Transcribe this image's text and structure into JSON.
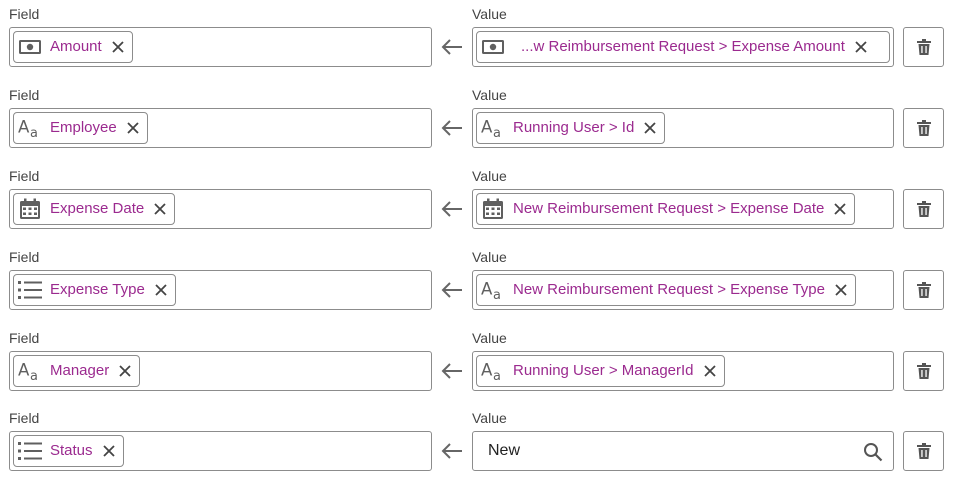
{
  "mappings": [
    {
      "field_label": "Field",
      "value_label": "Value",
      "field": {
        "icon": "money-icon",
        "text": "Amount"
      },
      "value": {
        "icon": "money-icon",
        "text": "...w Reimbursement Request > Expense Amount"
      }
    },
    {
      "field_label": "Field",
      "value_label": "Value",
      "field": {
        "icon": "text-type-icon",
        "text": "Employee"
      },
      "value": {
        "icon": "text-type-icon",
        "text": "Running User > Id"
      }
    },
    {
      "field_label": "Field",
      "value_label": "Value",
      "field": {
        "icon": "calendar-icon",
        "text": "Expense Date"
      },
      "value": {
        "icon": "calendar-icon",
        "text": "New Reimbursement Request > Expense Date"
      }
    },
    {
      "field_label": "Field",
      "value_label": "Value",
      "field": {
        "icon": "list-icon",
        "text": "Expense Type"
      },
      "value": {
        "icon": "text-type-icon",
        "text": "New Reimbursement Request > Expense Type"
      }
    },
    {
      "field_label": "Field",
      "value_label": "Value",
      "field": {
        "icon": "text-type-icon",
        "text": "Manager"
      },
      "value": {
        "icon": "text-type-icon",
        "text": "Running User > ManagerId"
      }
    },
    {
      "field_label": "Field",
      "value_label": "Value",
      "field": {
        "icon": "list-icon",
        "text": "Status"
      },
      "value": {
        "plain": "New",
        "icon": "search-icon"
      }
    }
  ],
  "colors": {
    "token_text": "#9b2a8f",
    "border": "#8c8c8c",
    "icon": "#5f5f5f"
  }
}
